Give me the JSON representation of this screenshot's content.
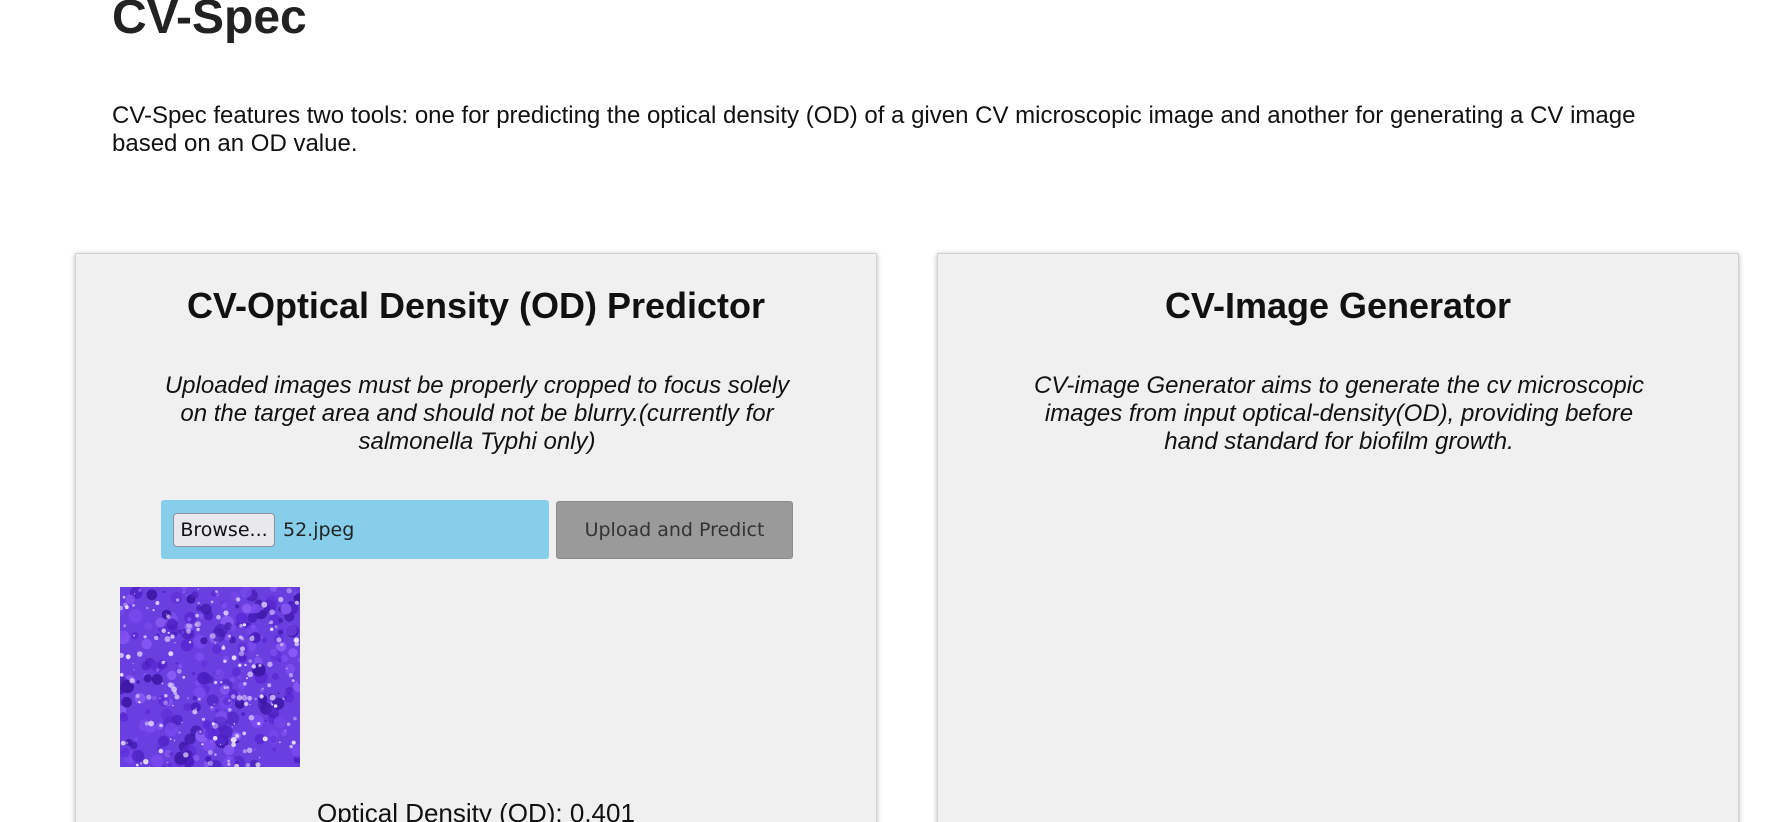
{
  "header": {
    "title": "CV-Spec",
    "intro": "CV-Spec features two tools: one for predicting the optical density (OD) of a given CV microscopic image and another for generating a CV image based on an OD value."
  },
  "predictor": {
    "title": "CV-Optical Density (OD) Predictor",
    "description": "Uploaded images must be properly cropped to focus solely on the target area and should not be blurry.(currently for salmonella Typhi only)",
    "browse_label": "Browse...",
    "file_name": "52.jpeg",
    "upload_label": "Upload and Predict",
    "result_text": "Optical Density (OD): 0.401"
  },
  "generator": {
    "title": "CV-Image Generator",
    "description": "CV-image Generator aims to generate the cv microscopic images from input optical-density(OD), providing before hand standard for biofilm growth."
  },
  "colors": {
    "card_background": "#f0f0f0",
    "file_input_background": "#87ceeb",
    "upload_button_background": "#9a9a9a",
    "preview_stain": "#6a3fe0"
  }
}
